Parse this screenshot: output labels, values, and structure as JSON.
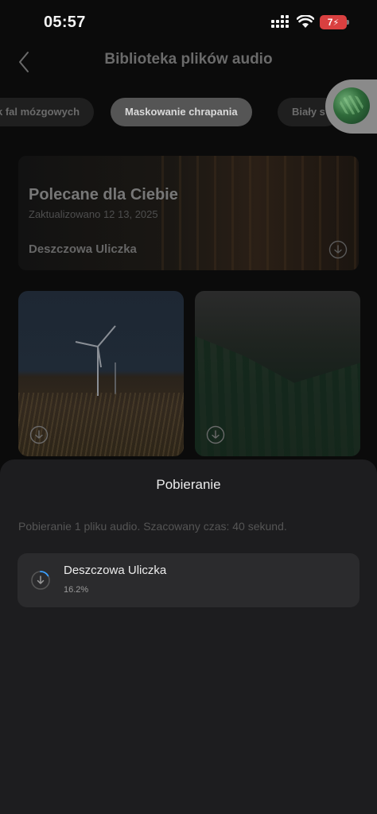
{
  "status_bar": {
    "time": "05:57",
    "battery": "7",
    "icons": [
      "signal-icon",
      "wifi-icon",
      "battery-charging-icon"
    ]
  },
  "header": {
    "title": "Biblioteka plików audio",
    "back_icon": "chevron-left-icon"
  },
  "categories": {
    "items": [
      {
        "label": "k fal mózgowych",
        "selected": false
      },
      {
        "label": "Maskowanie chrapania",
        "selected": true
      },
      {
        "label": "Biały s",
        "selected": false
      }
    ]
  },
  "featured": {
    "title": "Polecane dla Ciebie",
    "subtitle": "Zaktualizowano 12 13, 2025",
    "track": "Deszczowa Uliczka",
    "download_icon": "download-icon"
  },
  "cards": [
    {
      "image": "wind-turbine-field",
      "download_icon": "download-icon"
    },
    {
      "image": "misty-forest",
      "download_icon": "download-icon"
    }
  ],
  "download_sheet": {
    "title": "Pobieranie",
    "description": "Pobieranie 1 pliku audio. Szacowany czas: 40 sekund.",
    "items": [
      {
        "name": "Deszczowa Uliczka",
        "progress_text": "16.2%",
        "progress_value": 0.162
      }
    ]
  },
  "colors": {
    "background": "#0b0b0b",
    "sheet": "#1d1d1f",
    "item": "#2b2b2d",
    "progress_accent": "#3aa0ff",
    "battery": "#d94040"
  }
}
